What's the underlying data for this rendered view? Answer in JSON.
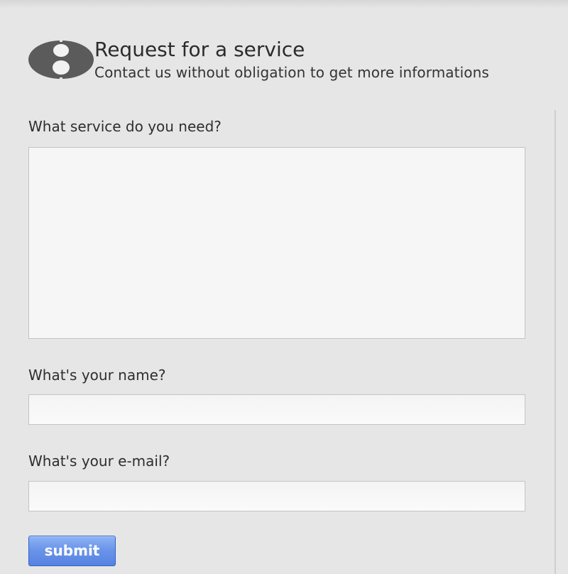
{
  "header": {
    "title": "Request for a service",
    "subtitle": "Contact us without obligation to get more informations",
    "logo_icon": "figure-eight-logo-icon"
  },
  "form": {
    "service": {
      "label": "What service do you need?",
      "value": "",
      "placeholder": ""
    },
    "name": {
      "label": "What's your name?",
      "value": "",
      "placeholder": ""
    },
    "email": {
      "label": "What's your e-mail?",
      "value": "",
      "placeholder": ""
    },
    "submit_label": "submit"
  },
  "colors": {
    "background": "#e6e6e6",
    "field_background": "#f6f6f6",
    "field_border": "#c4c4c4",
    "logo": "#5b5b5b",
    "submit_background": "#6b95ea",
    "submit_border": "#2f63c8",
    "submit_text": "#ffffff"
  }
}
